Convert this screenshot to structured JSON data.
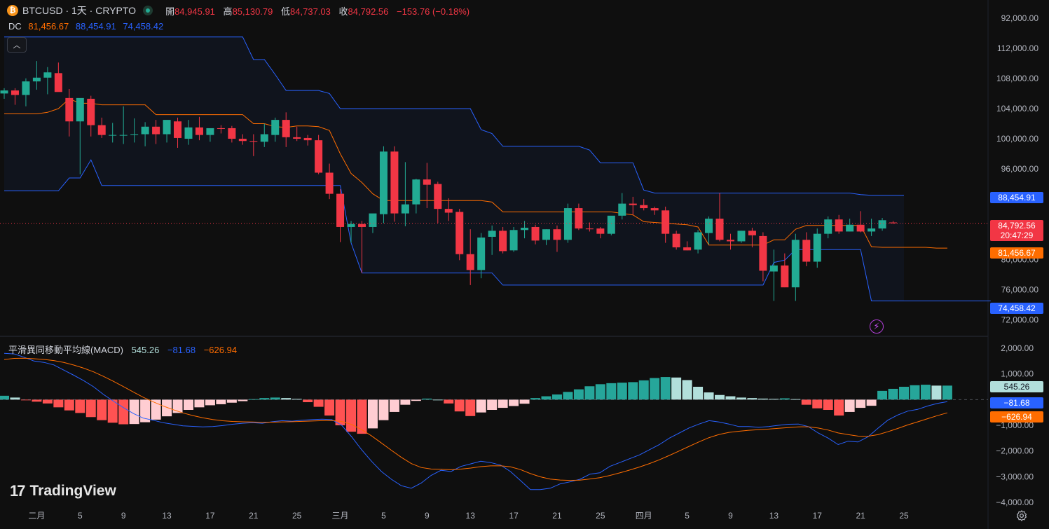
{
  "header": {
    "symbol": "BTCUSD · 1天 · CRYPTO",
    "coin_glyph": "₿",
    "open_label": "開",
    "open": "84,945.91",
    "high_label": "高",
    "high": "85,130.79",
    "low_label": "低",
    "low": "84,737.03",
    "close_label": "收",
    "close": "84,792.56",
    "change": "−153.76 (−0.18%)"
  },
  "dc_legend": {
    "label": "DC",
    "mid": "81,456.67",
    "upper": "88,454.91",
    "lower": "74,458.42"
  },
  "macd_legend": {
    "label": "平滑異同移動平均線(MACD)",
    "hist": "545.26",
    "macd": "−81.68",
    "signal": "−626.94"
  },
  "badges": {
    "upper": "88,454.91",
    "price": "84,792.56",
    "countdown": "20:47:29",
    "mid": "81,456.67",
    "lower": "74,458.42",
    "hist": "545.26",
    "macd": "−81.68",
    "signal": "−626.94"
  },
  "brand": {
    "name": "TradingView",
    "mark": "17"
  },
  "colors": {
    "up": "#22ab94",
    "down": "#f23645",
    "dc_band": "#2962ff",
    "dc_mid": "#ff6d00",
    "macd": "#2962ff",
    "signal": "#ff6d00",
    "hist_up_strong": "#26a69a",
    "hist_up_weak": "#b2dfdb",
    "hist_down_strong": "#ff5252",
    "hist_down_weak": "#ffcdd2",
    "background": "#0f0f0f"
  },
  "icons": [
    "coin-icon",
    "live-icon",
    "collapse-icon",
    "lightning-icon",
    "gear-icon",
    "tradingview-logo"
  ],
  "chart_data": [
    {
      "type": "candlestick",
      "title": "BTCUSD · 1天 · CRYPTO",
      "x_tick_labels": [
        "二月",
        "5",
        "9",
        "13",
        "17",
        "21",
        "25",
        "三月",
        "5",
        "9",
        "13",
        "17",
        "21",
        "25",
        "四月",
        "5",
        "9",
        "13",
        "17",
        "21",
        "25"
      ],
      "y_tick_labels": [
        "72,000.00",
        "76,000.00",
        "80,000.00",
        "96,000.00",
        "100,000.00",
        "104,000.00",
        "108,000.00",
        "112,000.00",
        "92,000.00"
      ],
      "y_ticks": [
        72000,
        76000,
        80000,
        92000,
        96000,
        100000,
        104000,
        108000,
        112000
      ],
      "ylim": [
        71200,
        113000
      ],
      "first_date": "2025-01-29",
      "candles": [
        [
          102000,
          102700,
          101300,
          102400
        ],
        [
          102400,
          102700,
          100500,
          101800
        ],
        [
          101800,
          104000,
          100300,
          103600
        ],
        [
          103600,
          106300,
          102500,
          104100
        ],
        [
          104100,
          105500,
          101900,
          104800
        ],
        [
          104700,
          106100,
          102700,
          102200
        ],
        [
          101400,
          102600,
          96300,
          98300
        ],
        [
          98300,
          101200,
          91300,
          101400
        ],
        [
          101300,
          101700,
          96300,
          97800
        ],
        [
          97800,
          98800,
          96100,
          96500
        ],
        [
          96500,
          98100,
          95500,
          96500
        ],
        [
          96500,
          100300,
          95300,
          96500
        ],
        [
          96500,
          98700,
          95500,
          96600
        ],
        [
          96600,
          98200,
          95000,
          97600
        ],
        [
          97600,
          98500,
          95300,
          96600
        ],
        [
          96600,
          98200,
          95500,
          98500
        ],
        [
          98300,
          98800,
          94800,
          96100
        ],
        [
          96000,
          98500,
          95200,
          97500
        ],
        [
          97500,
          98900,
          95800,
          96500
        ],
        [
          96500,
          97200,
          95600,
          97400
        ],
        [
          97400,
          97800,
          96700,
          97300
        ],
        [
          97400,
          97700,
          95500,
          96000
        ],
        [
          96000,
          96600,
          95200,
          95700
        ],
        [
          95700,
          96600,
          93700,
          95600
        ],
        [
          95600,
          98000,
          94900,
          96600
        ],
        [
          96500,
          98800,
          95600,
          98500
        ],
        [
          98500,
          99500,
          94900,
          96200
        ],
        [
          96200,
          97600,
          95700,
          96000
        ],
        [
          96100,
          96500,
          95100,
          95800
        ],
        [
          95800,
          96500,
          91300,
          91500
        ],
        [
          91500,
          92700,
          88000,
          88700
        ],
        [
          88700,
          89300,
          82300,
          84300
        ],
        [
          84300,
          85100,
          82200,
          84700
        ],
        [
          84700,
          85100,
          78200,
          84300
        ],
        [
          84300,
          85800,
          83500,
          86100
        ],
        [
          86000,
          95000,
          84800,
          94300
        ],
        [
          94300,
          95000,
          85000,
          86100
        ],
        [
          86100,
          92900,
          84400,
          87300
        ],
        [
          87300,
          90700,
          86100,
          90600
        ],
        [
          90600,
          92800,
          86800,
          89900
        ],
        [
          90000,
          90300,
          84800,
          86700
        ],
        [
          86700,
          88100,
          85100,
          86200
        ],
        [
          86300,
          86700,
          79900,
          80700
        ],
        [
          80700,
          84000,
          76600,
          78600
        ],
        [
          78600,
          83500,
          77500,
          82900
        ],
        [
          83000,
          84500,
          80600,
          83800
        ],
        [
          83800,
          84300,
          80800,
          81100
        ],
        [
          81200,
          84300,
          81000,
          83900
        ],
        [
          83900,
          85100,
          82800,
          84200
        ],
        [
          84300,
          84600,
          82000,
          82500
        ],
        [
          82600,
          84000,
          81900,
          84000
        ],
        [
          84000,
          84500,
          81000,
          82600
        ],
        [
          82600,
          87400,
          82200,
          86800
        ],
        [
          86800,
          87400,
          83900,
          84100
        ],
        [
          84100,
          84900,
          83700,
          84000
        ],
        [
          84100,
          84300,
          82800,
          83400
        ],
        [
          83400,
          84700,
          83200,
          85800
        ],
        [
          85800,
          88800,
          85300,
          87400
        ],
        [
          87400,
          88300,
          85900,
          87200
        ],
        [
          87200,
          88000,
          86500,
          86800
        ],
        [
          86800,
          87000,
          85900,
          86500
        ],
        [
          86500,
          87000,
          82200,
          83400
        ],
        [
          83400,
          83800,
          81300,
          81600
        ],
        [
          81600,
          82400,
          81200,
          81200
        ],
        [
          81300,
          83900,
          80800,
          83600
        ],
        [
          83500,
          85700,
          82000,
          85400
        ],
        [
          85400,
          88800,
          82400,
          82600
        ],
        [
          82600,
          83400,
          81300,
          82400
        ],
        [
          82400,
          83800,
          82200,
          83800
        ],
        [
          83800,
          84200,
          81600,
          83200
        ],
        [
          83100,
          83600,
          77100,
          78500
        ],
        [
          78400,
          81300,
          74500,
          79200
        ],
        [
          79200,
          80800,
          76300,
          76300
        ],
        [
          76300,
          83400,
          74500,
          82600
        ],
        [
          82600,
          83600,
          79100,
          79700
        ],
        [
          79700,
          84100,
          78900,
          83400
        ],
        [
          83400,
          85700,
          82800,
          85300
        ],
        [
          85300,
          85900,
          83400,
          83700
        ],
        [
          83700,
          85400,
          83700,
          84600
        ],
        [
          84600,
          86400,
          83600,
          83700
        ],
        [
          83700,
          85400,
          83100,
          84100
        ],
        [
          84100,
          85500,
          83800,
          85200
        ],
        [
          84900,
          85100,
          84700,
          84800
        ]
      ],
      "dc_upper": [
        109500,
        109500,
        109500,
        109500,
        109500,
        109500,
        109500,
        109500,
        109500,
        109500,
        109500,
        109500,
        109500,
        109500,
        109500,
        109500,
        109500,
        109500,
        109500,
        109500,
        109500,
        109500,
        109500,
        106500,
        106500,
        104500,
        102400,
        102400,
        102400,
        102400,
        102000,
        100000,
        100000,
        100000,
        100000,
        100000,
        100000,
        100000,
        100000,
        100000,
        100000,
        100000,
        100000,
        100000,
        97200,
        96700,
        95000,
        95000,
        95000,
        95000,
        95000,
        95000,
        95000,
        95000,
        94500,
        92800,
        92800,
        92800,
        92800,
        89200,
        88800,
        88800,
        88800,
        88800,
        88800,
        88800,
        88800,
        88800,
        88800,
        88800,
        88800,
        88800,
        88800,
        88800,
        88800,
        88800,
        88800,
        88800,
        88800,
        88600,
        88500,
        88500,
        88500,
        88500
      ],
      "dc_mid": [
        99300,
        99300,
        99300,
        99300,
        99500,
        100000,
        101300,
        100700,
        100700,
        100500,
        100500,
        100500,
        100500,
        100500,
        99200,
        99200,
        99200,
        99200,
        99200,
        99200,
        99200,
        99200,
        99200,
        98000,
        98000,
        97600,
        97500,
        97700,
        97700,
        97600,
        97100,
        94000,
        91400,
        90200,
        88700,
        87800,
        87800,
        87800,
        87800,
        87800,
        87800,
        87800,
        87800,
        87800,
        87800,
        87600,
        86300,
        86300,
        86300,
        86300,
        86300,
        86300,
        86300,
        86300,
        86300,
        86300,
        86300,
        86100,
        85900,
        85000,
        84900,
        84800,
        84700,
        84600,
        84300,
        81900,
        81900,
        81900,
        81900,
        81900,
        81900,
        82600,
        82600,
        84000,
        84500,
        84500,
        84500,
        84500,
        84500,
        84500,
        81700,
        81600,
        81600,
        81600,
        81600,
        81600,
        81500,
        81500
      ],
      "dc_lower": [
        89100,
        89100,
        89100,
        89100,
        89100,
        89100,
        90800,
        90800,
        93200,
        89800,
        89800,
        89800,
        89800,
        89800,
        89800,
        89800,
        89800,
        89800,
        89800,
        89800,
        89800,
        89800,
        89800,
        89800,
        89800,
        89800,
        89800,
        89800,
        89800,
        89800,
        89800,
        89800,
        82200,
        78200,
        78200,
        78200,
        78200,
        78200,
        78200,
        78200,
        78200,
        78200,
        78200,
        78200,
        78200,
        78200,
        76600,
        76600,
        76600,
        76600,
        76600,
        76600,
        76600,
        76600,
        76600,
        76600,
        76600,
        76600,
        76600,
        76600,
        76600,
        76600,
        76600,
        76600,
        76600,
        76600,
        76600,
        76600,
        76600,
        76600,
        76600,
        79600,
        79900,
        81300,
        81300,
        81300,
        81300,
        81300,
        81300,
        81300,
        74500,
        74500,
        74500,
        74500,
        74500,
        74500,
        74500,
        74500,
        74500,
        74500,
        74500,
        74500
      ]
    },
    {
      "type": "macd",
      "title": "平滑異同移動平均線(MACD)",
      "y_tick_labels": [
        "2,000.00",
        "1,000.00",
        "−1,000.00",
        "−2,000.00",
        "−3,000.00",
        "−4,000.00"
      ],
      "y_ticks": [
        2000,
        1000,
        -1000,
        -2000,
        -3000,
        -4000
      ],
      "ylim": [
        -4100,
        2200
      ],
      "histogram": [
        150,
        80,
        -20,
        -80,
        -150,
        -300,
        -420,
        -520,
        -680,
        -800,
        -900,
        -960,
        -950,
        -880,
        -780,
        -650,
        -520,
        -400,
        -300,
        -220,
        -180,
        -120,
        -60,
        20,
        60,
        80,
        60,
        30,
        -100,
        -280,
        -620,
        -1000,
        -1250,
        -1330,
        -1120,
        -800,
        -480,
        -200,
        -50,
        40,
        0,
        -150,
        -460,
        -640,
        -500,
        -400,
        -320,
        -250,
        -160,
        60,
        130,
        200,
        300,
        400,
        520,
        600,
        640,
        660,
        680,
        750,
        840,
        880,
        860,
        760,
        500,
        280,
        180,
        130,
        80,
        60,
        40,
        30,
        50,
        20,
        -200,
        -340,
        -400,
        -620,
        -480,
        -320,
        -240,
        340,
        420,
        500,
        560,
        580,
        545,
        545
      ],
      "macd": [
        1800,
        1780,
        1650,
        1500,
        1450,
        1350,
        1150,
        950,
        740,
        500,
        200,
        -60,
        -310,
        -540,
        -720,
        -800,
        -900,
        -960,
        -1020,
        -1040,
        -1060,
        -1050,
        -1010,
        -960,
        -920,
        -900,
        -920,
        -860,
        -820,
        -840,
        -800,
        -780,
        -760,
        -780,
        -1000,
        -1450,
        -1950,
        -2400,
        -2800,
        -3100,
        -3350,
        -3450,
        -3250,
        -2950,
        -2750,
        -2800,
        -2600,
        -2500,
        -2400,
        -2450,
        -2550,
        -2800,
        -3150,
        -3500,
        -3500,
        -3450,
        -3280,
        -3200,
        -3100,
        -2900,
        -2850,
        -2600,
        -2450,
        -2300,
        -2150,
        -1950,
        -1750,
        -1500,
        -1300,
        -1100,
        -950,
        -820,
        -870,
        -950,
        -1050,
        -1050,
        -1080,
        -1050,
        -1000,
        -960,
        -950,
        -1050,
        -1300,
        -1500,
        -1750,
        -1620,
        -1650,
        -1450,
        -1120,
        -800,
        -600,
        -450,
        -380,
        -250,
        -150,
        -80
      ]
    }
  ]
}
